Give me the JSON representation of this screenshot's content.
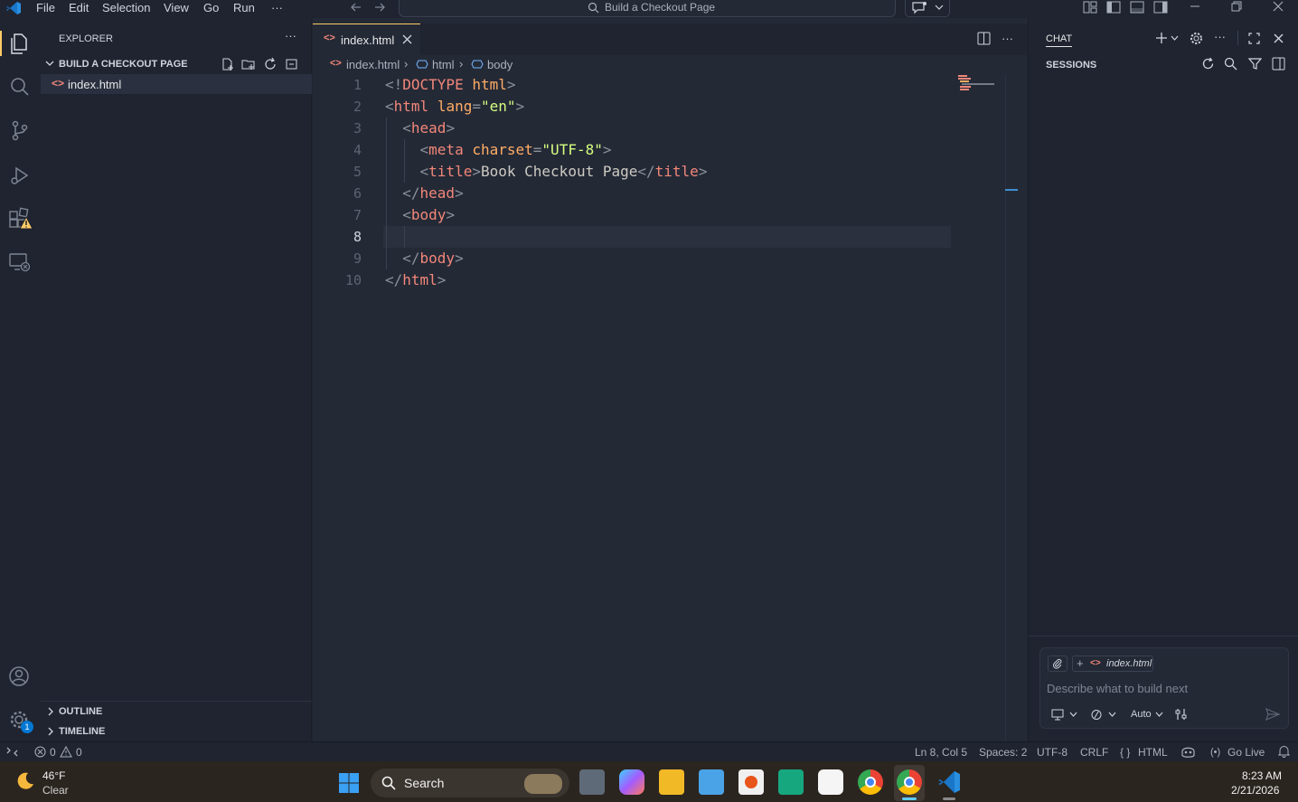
{
  "menu": [
    "File",
    "Edit",
    "Selection",
    "View",
    "Go",
    "Run",
    "···"
  ],
  "command_center": {
    "title": "Build a Checkout Page"
  },
  "sidebar": {
    "title": "EXPLORER",
    "more": "···",
    "folder": "BUILD A CHECKOUT PAGE",
    "files": [
      "index.html"
    ],
    "outline": "OUTLINE",
    "timeline": "TIMELINE"
  },
  "editor": {
    "tab_label": "index.html",
    "breadcrumb": [
      "index.html",
      "html",
      "body"
    ],
    "line_numbers": [
      "1",
      "2",
      "3",
      "4",
      "5",
      "6",
      "7",
      "8",
      "9",
      "10"
    ],
    "lines": [
      "<!DOCTYPE html>",
      "<html lang=\"en\">",
      "  <head>",
      "    <meta charset=\"UTF-8\">",
      "    <title>Book Checkout Page</title>",
      "  </head>",
      "  <body>",
      "",
      "  </body>",
      "</html>"
    ],
    "more": "···"
  },
  "chat": {
    "tab": "CHAT",
    "sessions": "SESSIONS",
    "more": "···",
    "context_file": "index.html",
    "placeholder": "Describe what to build next",
    "mode": "Auto"
  },
  "statusbar": {
    "errors": "0",
    "warnings": "0",
    "position": "Ln 8, Col 5",
    "spaces": "Spaces: 2",
    "encoding": "UTF-8",
    "eol": "CRLF",
    "language": "HTML",
    "golive": "Go Live"
  },
  "taskbar": {
    "temperature": "46°F",
    "weather": "Clear",
    "search": "Search",
    "time": "8:23 AM",
    "date": "2/21/2026"
  },
  "colors": {
    "accent": "#ffcc66",
    "tag": "#f28779",
    "attr": "#ffad66",
    "string": "#d5ff80",
    "vscode_blue": "#0078d4"
  }
}
